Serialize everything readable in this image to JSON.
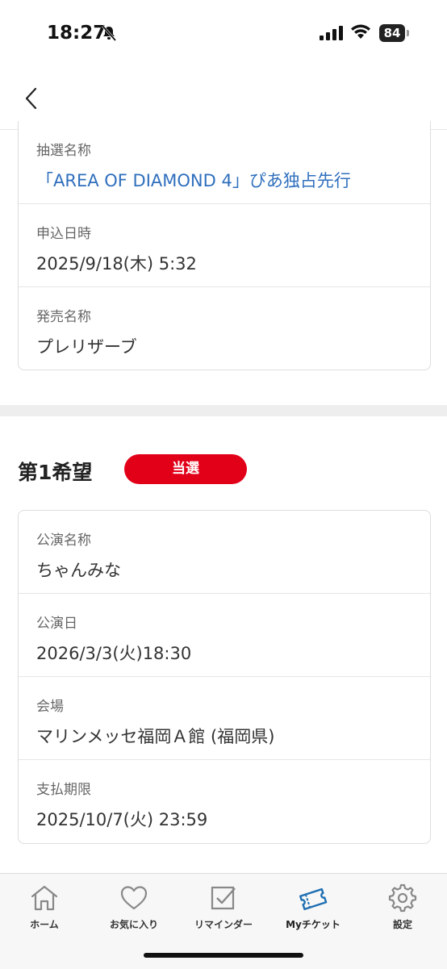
{
  "status": {
    "time": "18:27",
    "battery": "84"
  },
  "lottery": {
    "rows": [
      {
        "label": "抽選名称",
        "value": "「AREA OF DIAMOND 4」ぴあ独占先行"
      },
      {
        "label": "申込日時",
        "value": "2025/9/18(木) 5:32"
      },
      {
        "label": "発売名称",
        "value": "プレリザーブ"
      }
    ]
  },
  "choice": {
    "title": "第1希望",
    "badge": "当選",
    "rows": [
      {
        "label": "公演名称",
        "value": "ちゃんみな"
      },
      {
        "label": "公演日",
        "value": "2026/3/3(火)18:30"
      },
      {
        "label": "会場",
        "value": "マリンメッセ福岡Ａ館 (福岡県)"
      },
      {
        "label": "支払期限",
        "value": "2025/10/7(火) 23:59"
      }
    ]
  },
  "tabbar": {
    "items": [
      {
        "label": "ホーム",
        "icon": "home-icon"
      },
      {
        "label": "お気に入り",
        "icon": "heart-icon"
      },
      {
        "label": "リマインダー",
        "icon": "checkbox-icon"
      },
      {
        "label": "Myチケット",
        "icon": "ticket-icon"
      },
      {
        "label": "設定",
        "icon": "gear-icon"
      }
    ]
  },
  "colors": {
    "accent_red": "#e20019",
    "link_blue": "#2f6fbd",
    "ticket_blue": "#1f6fb2"
  }
}
